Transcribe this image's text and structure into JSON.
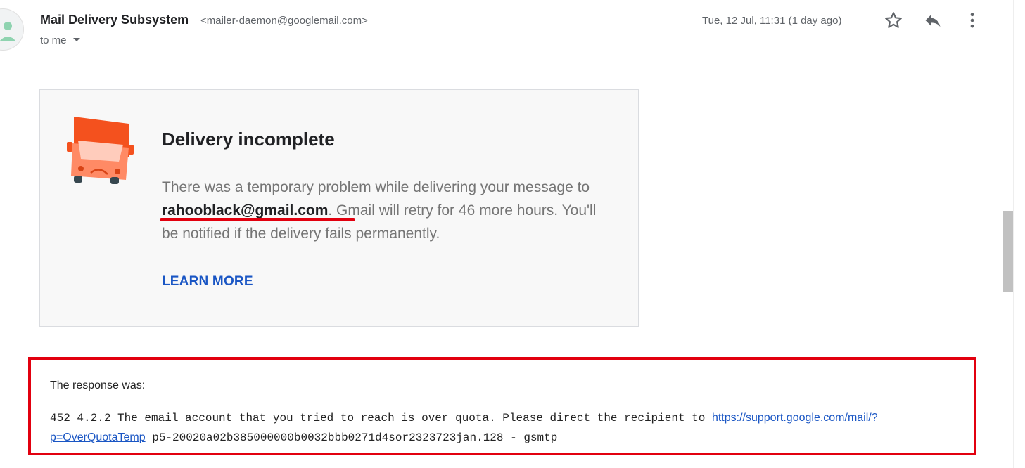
{
  "message_header": {
    "sender_name": "Mail Delivery Subsystem",
    "sender_email": "<mailer-daemon@googlemail.com>",
    "recipient_label": "to me",
    "date": "Tue, 12 Jul, 11:31 (1 day ago)",
    "icons": [
      "avatar-person-icon",
      "star-icon",
      "reply-icon",
      "more-vert-icon",
      "chevron-down-icon"
    ]
  },
  "delivery_card": {
    "icon": "sad-truck-icon",
    "title": "Delivery incomplete",
    "body_before": "There was a temporary problem while delivering your message to ",
    "recipient": "rahooblack@gmail.com",
    "body_after": ". Gmail will retry for 46 more hours. You'll be notified if the delivery fails permanently.",
    "learn_more_label": "LEARN MORE"
  },
  "response": {
    "label": "The response was:",
    "text_before": "452 4.2.2 The email account that you tried to reach is over quota. Please direct the recipient to ",
    "link_text": "https://support.google.com/mail/?p=OverQuotaTemp",
    "text_after": " p5-20020a02b385000000b0032bbb0271d4sor2323723jan.128 - gsmtp"
  },
  "colors": {
    "accent_link": "#1a56c4",
    "highlight_red": "#e2000f",
    "truck_orange": "#f4511e"
  }
}
